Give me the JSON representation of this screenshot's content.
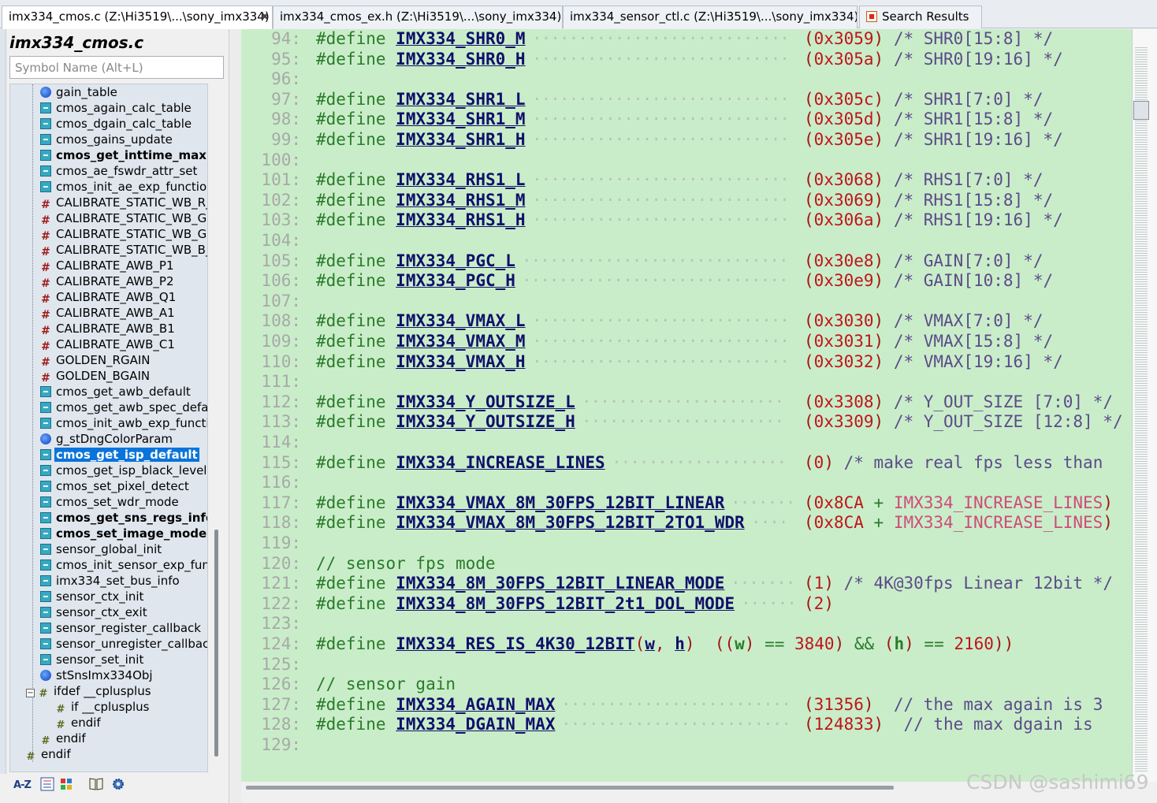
{
  "tabs": [
    {
      "label": "imx334_cmos.c (Z:\\Hi3519\\...\\sony_imx334)",
      "close": "✖",
      "active": true
    },
    {
      "label": "imx334_cmos_ex.h (Z:\\Hi3519\\...\\sony_imx334)",
      "active": false
    },
    {
      "label": "imx334_sensor_ctl.c (Z:\\Hi3519\\...\\sony_imx334)",
      "active": false
    },
    {
      "label": "Search Results",
      "active": false,
      "icon": "search-results-icon"
    }
  ],
  "symbol_panel": {
    "file_title": "imx334_cmos.c",
    "search_placeholder": "Symbol Name (Alt+L)",
    "items": [
      {
        "label": "gain_table",
        "icon": "variable-icon"
      },
      {
        "label": "cmos_again_calc_table",
        "icon": "function-icon"
      },
      {
        "label": "cmos_dgain_calc_table",
        "icon": "function-icon"
      },
      {
        "label": "cmos_gains_update",
        "icon": "function-icon"
      },
      {
        "label": "cmos_get_inttime_max",
        "icon": "function-icon",
        "bold": true
      },
      {
        "label": "cmos_ae_fswdr_attr_set",
        "icon": "function-icon"
      },
      {
        "label": "cmos_init_ae_exp_function",
        "icon": "function-icon"
      },
      {
        "label": "CALIBRATE_STATIC_WB_R_",
        "icon": "macro-icon"
      },
      {
        "label": "CALIBRATE_STATIC_WB_GR",
        "icon": "macro-icon"
      },
      {
        "label": "CALIBRATE_STATIC_WB_GB",
        "icon": "macro-icon"
      },
      {
        "label": "CALIBRATE_STATIC_WB_B_",
        "icon": "macro-icon"
      },
      {
        "label": "CALIBRATE_AWB_P1",
        "icon": "macro-icon"
      },
      {
        "label": "CALIBRATE_AWB_P2",
        "icon": "macro-icon"
      },
      {
        "label": "CALIBRATE_AWB_Q1",
        "icon": "macro-icon"
      },
      {
        "label": "CALIBRATE_AWB_A1",
        "icon": "macro-icon"
      },
      {
        "label": "CALIBRATE_AWB_B1",
        "icon": "macro-icon"
      },
      {
        "label": "CALIBRATE_AWB_C1",
        "icon": "macro-icon"
      },
      {
        "label": "GOLDEN_RGAIN",
        "icon": "macro-icon"
      },
      {
        "label": "GOLDEN_BGAIN",
        "icon": "macro-icon"
      },
      {
        "label": "cmos_get_awb_default",
        "icon": "function-icon"
      },
      {
        "label": "cmos_get_awb_spec_default",
        "icon": "function-icon"
      },
      {
        "label": "cmos_init_awb_exp_function",
        "icon": "function-icon"
      },
      {
        "label": "g_stDngColorParam",
        "icon": "variable-icon"
      },
      {
        "label": "cmos_get_isp_default",
        "icon": "function-icon",
        "bold": true,
        "selected": true
      },
      {
        "label": "cmos_get_isp_black_level",
        "icon": "function-icon"
      },
      {
        "label": "cmos_set_pixel_detect",
        "icon": "function-icon"
      },
      {
        "label": "cmos_set_wdr_mode",
        "icon": "function-icon"
      },
      {
        "label": "cmos_get_sns_regs_info",
        "icon": "function-icon",
        "bold": true
      },
      {
        "label": "cmos_set_image_mode",
        "icon": "function-icon",
        "bold": true
      },
      {
        "label": "sensor_global_init",
        "icon": "function-icon"
      },
      {
        "label": "cmos_init_sensor_exp_function",
        "icon": "function-icon"
      },
      {
        "label": "imx334_set_bus_info",
        "icon": "function-icon"
      },
      {
        "label": "sensor_ctx_init",
        "icon": "function-icon"
      },
      {
        "label": "sensor_ctx_exit",
        "icon": "function-icon"
      },
      {
        "label": "sensor_register_callback",
        "icon": "function-icon"
      },
      {
        "label": "sensor_unregister_callback",
        "icon": "function-icon"
      },
      {
        "label": "sensor_set_init",
        "icon": "function-icon"
      },
      {
        "label": "stSnsImx334Obj",
        "icon": "variable-icon"
      },
      {
        "label": "ifdef __cplusplus",
        "icon": "ifdef-icon",
        "collapse": "−"
      },
      {
        "label": "if __cplusplus",
        "icon": "ifdef-icon",
        "indent": 1
      },
      {
        "label": "endif",
        "icon": "ifdef-icon",
        "indent": 1
      },
      {
        "label": "endif",
        "icon": "ifdef-icon"
      },
      {
        "label": "endif",
        "icon": "ifdef-icon",
        "indent": -1
      }
    ]
  },
  "panel_toolbar": {
    "sort_label": "A-Z"
  },
  "code_lines": [
    {
      "n": "94:",
      "kw": "#define",
      "name": "IMX334_SHR0_M",
      "val": "0x3059",
      "comment": "/* SHR0[15:8] */"
    },
    {
      "n": "95:",
      "kw": "#define",
      "name": "IMX334_SHR0_H",
      "val": "0x305a",
      "comment": "/* SHR0[19:16] */"
    },
    {
      "n": "96:"
    },
    {
      "n": "97:",
      "kw": "#define",
      "name": "IMX334_SHR1_L",
      "val": "0x305c",
      "comment": "/* SHR1[7:0] */"
    },
    {
      "n": "98:",
      "kw": "#define",
      "name": "IMX334_SHR1_M",
      "val": "0x305d",
      "comment": "/* SHR1[15:8] */"
    },
    {
      "n": "99:",
      "kw": "#define",
      "name": "IMX334_SHR1_H",
      "val": "0x305e",
      "comment": "/* SHR1[19:16] */"
    },
    {
      "n": "100:"
    },
    {
      "n": "101:",
      "kw": "#define",
      "name": "IMX334_RHS1_L",
      "val": "0x3068",
      "comment": "/* RHS1[7:0] */"
    },
    {
      "n": "102:",
      "kw": "#define",
      "name": "IMX334_RHS1_M",
      "val": "0x3069",
      "comment": "/* RHS1[15:8] */"
    },
    {
      "n": "103:",
      "kw": "#define",
      "name": "IMX334_RHS1_H",
      "val": "0x306a",
      "comment": "/* RHS1[19:16] */"
    },
    {
      "n": "104:"
    },
    {
      "n": "105:",
      "kw": "#define",
      "name": "IMX334_PGC_L",
      "val": "0x30e8",
      "comment": "/* GAIN[7:0] */"
    },
    {
      "n": "106:",
      "kw": "#define",
      "name": "IMX334_PGC_H",
      "val": "0x30e9",
      "comment": "/* GAIN[10:8] */"
    },
    {
      "n": "107:"
    },
    {
      "n": "108:",
      "kw": "#define",
      "name": "IMX334_VMAX_L",
      "val": "0x3030",
      "comment": "/* VMAX[7:0] */"
    },
    {
      "n": "109:",
      "kw": "#define",
      "name": "IMX334_VMAX_M",
      "val": "0x3031",
      "comment": "/* VMAX[15:8] */"
    },
    {
      "n": "110:",
      "kw": "#define",
      "name": "IMX334_VMAX_H",
      "val": "0x3032",
      "comment": "/* VMAX[19:16] */"
    },
    {
      "n": "111:"
    },
    {
      "n": "112:",
      "kw": "#define",
      "name": "IMX334_Y_OUTSIZE_L",
      "val": "0x3308",
      "comment": "/* Y_OUT_SIZE [7:0] */"
    },
    {
      "n": "113:",
      "kw": "#define",
      "name": "IMX334_Y_OUTSIZE_H",
      "val": "0x3309",
      "comment": "/* Y_OUT_SIZE [12:8] */"
    },
    {
      "n": "114:"
    },
    {
      "n": "115:",
      "kw": "#define",
      "name": "IMX334_INCREASE_LINES",
      "val": "0",
      "comment": "/* make real fps less than"
    },
    {
      "n": "116:"
    },
    {
      "n": "117:",
      "kw": "#define",
      "name": "IMX334_VMAX_8M_30FPS_12BIT_LINEAR",
      "val": "0x8CA",
      "plus": "IMX334_INCREASE_LINES"
    },
    {
      "n": "118:",
      "kw": "#define",
      "name": "IMX334_VMAX_8M_30FPS_12BIT_2TO1_WDR",
      "val": "0x8CA",
      "plus": "IMX334_INCREASE_LINES"
    },
    {
      "n": "119:"
    },
    {
      "n": "120:",
      "line_comment": "// sensor fps mode"
    },
    {
      "n": "121:",
      "kw": "#define",
      "name": "IMX334_8M_30FPS_12BIT_LINEAR_MODE",
      "val": "1",
      "comment": "/* 4K@30fps Linear 12bit */"
    },
    {
      "n": "122:",
      "kw": "#define",
      "name": "IMX334_8M_30FPS_12BIT_2t1_DOL_MODE",
      "val": "2"
    },
    {
      "n": "123:"
    },
    {
      "n": "124:",
      "kw": "#define",
      "name": "IMX334_RES_IS_4K30_12BIT",
      "macro_fn": {
        "p1": "w",
        "p2": "h",
        "v1": "3840",
        "v2": "2160"
      }
    },
    {
      "n": "125:"
    },
    {
      "n": "126:",
      "line_comment": "// sensor gain"
    },
    {
      "n": "127:",
      "kw": "#define",
      "name": "IMX334_AGAIN_MAX",
      "val": "31356",
      "trail": "// the max again is 3"
    },
    {
      "n": "128:",
      "kw": "#define",
      "name": "IMX334_DGAIN_MAX",
      "val": "124833",
      "trail": "// the max dgain is"
    },
    {
      "n": "129:"
    }
  ],
  "watermark": "CSDN @sashimi69"
}
